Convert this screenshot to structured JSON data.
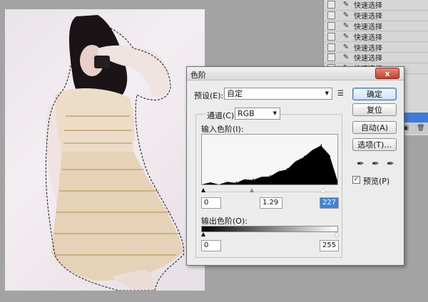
{
  "history": {
    "items": [
      {
        "label": "快速选择"
      },
      {
        "label": "快速选择"
      },
      {
        "label": "快速选择"
      },
      {
        "label": "快速选择"
      },
      {
        "label": "快速选择"
      },
      {
        "label": "快速选择"
      },
      {
        "label": "快速选择"
      }
    ],
    "icon": "brush-icon"
  },
  "dialog": {
    "title": "色阶",
    "close_label": "x",
    "preset_label": "预设(E):",
    "preset_value": "自定",
    "channel_label": "通道(C):",
    "channel_value": "RGB",
    "input_levels_label": "输入色阶(I):",
    "output_levels_label": "输出色阶(O):",
    "input_black": "0",
    "input_gamma": "1.29",
    "input_white": "227",
    "output_black": "0",
    "output_white": "255",
    "buttons": {
      "ok": "确定",
      "reset": "复位",
      "auto": "自动(A)",
      "options": "选项(T)..."
    },
    "preview_label": "预览(P)",
    "preview_checked": "✓",
    "accent_color": "#3f84d7",
    "close_color": "#c7402f"
  },
  "chart_data": {
    "type": "area",
    "description_source": "histogram of RGB channel in levels dialog",
    "x": [
      0,
      16,
      32,
      48,
      64,
      80,
      96,
      112,
      128,
      144,
      160,
      176,
      192,
      208,
      224,
      240,
      255
    ],
    "values": [
      0,
      0,
      0,
      1,
      3,
      6,
      9,
      11,
      16,
      22,
      30,
      42,
      55,
      65,
      78,
      55,
      8
    ],
    "xlim": [
      0,
      255
    ],
    "ylim": [
      0,
      100
    ]
  }
}
